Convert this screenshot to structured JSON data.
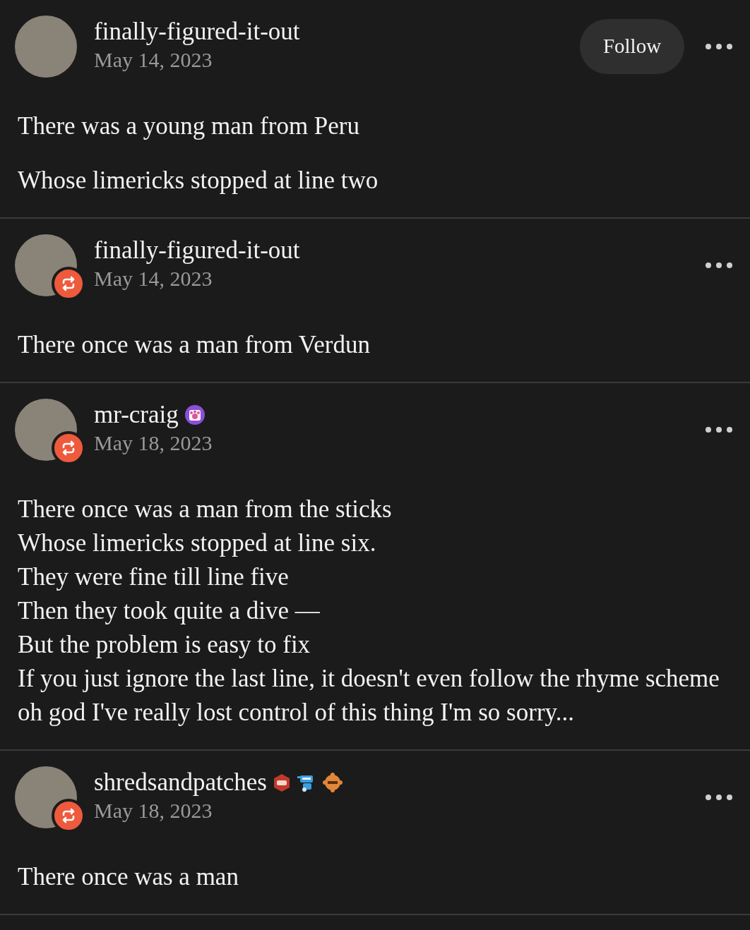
{
  "posts": [
    {
      "username": "finally-figured-it-out",
      "date": "May 14, 2023",
      "reblogged": false,
      "follow_button": "Follow",
      "paragraphs": [
        [
          "There was a young man from Peru"
        ],
        [
          "Whose limericks stopped at line two"
        ]
      ]
    },
    {
      "username": "finally-figured-it-out",
      "date": "May 14, 2023",
      "reblogged": true,
      "paragraphs": [
        [
          "There once was a man from Verdun"
        ]
      ]
    },
    {
      "username": "mr-craig",
      "date": "May 18, 2023",
      "reblogged": true,
      "badges": [
        {
          "kind": "paw"
        }
      ],
      "paragraphs": [
        [
          "There once was a man from the sticks",
          "Whose limericks stopped at line six.",
          "They were fine till line five",
          "Then they took quite a dive —",
          "But the problem is easy to fix",
          "If you just ignore the last line, it doesn't even follow the rhyme scheme",
          "oh god I've really lost control of this thing I'm so sorry..."
        ]
      ]
    },
    {
      "username": "shredsandpatches",
      "date": "May 18, 2023",
      "reblogged": true,
      "badges": [
        {
          "kind": "hexagon"
        },
        {
          "kind": "robot"
        },
        {
          "kind": "gear"
        }
      ],
      "paragraphs": [
        [
          "There once was a man"
        ]
      ]
    }
  ]
}
